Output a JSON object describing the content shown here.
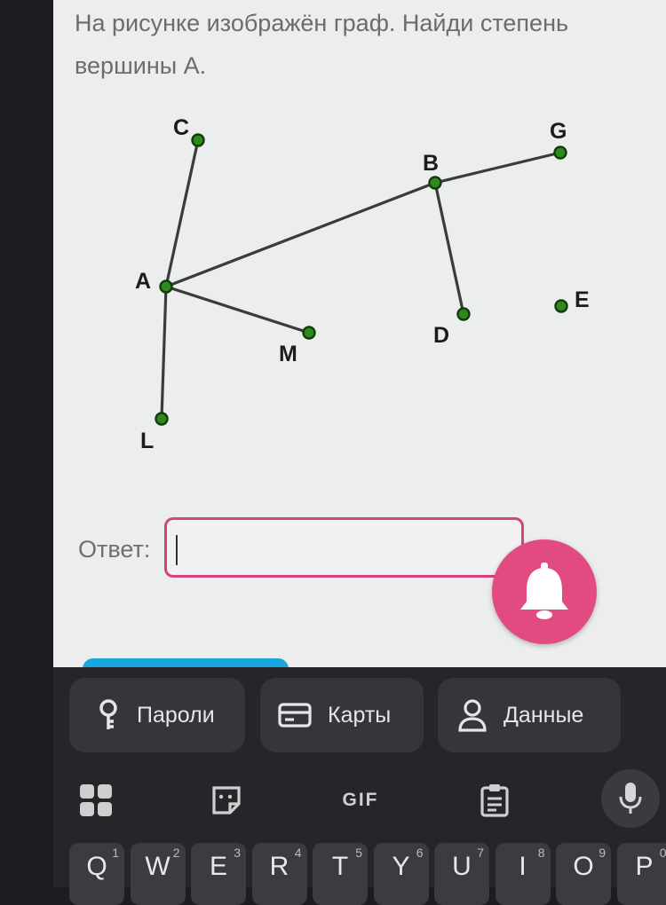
{
  "task": {
    "text": "На рисунке изображён граф. Найди степень вершины А."
  },
  "graph": {
    "vertices": [
      {
        "id": "C",
        "label": "C"
      },
      {
        "id": "B",
        "label": "B"
      },
      {
        "id": "G",
        "label": "G"
      },
      {
        "id": "A",
        "label": "A"
      },
      {
        "id": "E",
        "label": "E"
      },
      {
        "id": "D",
        "label": "D"
      },
      {
        "id": "M",
        "label": "M"
      },
      {
        "id": "L",
        "label": "L"
      }
    ],
    "edges": [
      [
        "A",
        "C"
      ],
      [
        "A",
        "B"
      ],
      [
        "A",
        "M"
      ],
      [
        "A",
        "L"
      ],
      [
        "B",
        "G"
      ],
      [
        "B",
        "D"
      ]
    ]
  },
  "answer": {
    "label": "Ответ:",
    "value": ""
  },
  "colors": {
    "accent": "#d6417f",
    "bell": "#e24b82",
    "node": "#2f8a1e",
    "primary_button": "#18a6dc"
  },
  "keyboard": {
    "suggestions": [
      {
        "label": "Пароли",
        "icon": "key-icon"
      },
      {
        "label": "Карты",
        "icon": "card-icon"
      },
      {
        "label": "Данные",
        "icon": "person-icon"
      }
    ],
    "tools": {
      "apps": "apps-grid-icon",
      "sticker": "sticker-icon",
      "gif": "GIF",
      "clipboard": "clipboard-icon",
      "mic": "microphone-icon"
    },
    "row1": [
      {
        "key": "Q",
        "num": "1"
      },
      {
        "key": "W",
        "num": "2"
      },
      {
        "key": "E",
        "num": "3"
      },
      {
        "key": "R",
        "num": "4"
      },
      {
        "key": "T",
        "num": "5"
      },
      {
        "key": "Y",
        "num": "6"
      },
      {
        "key": "U",
        "num": "7"
      },
      {
        "key": "I",
        "num": "8"
      },
      {
        "key": "O",
        "num": "9"
      },
      {
        "key": "P",
        "num": "0"
      }
    ]
  }
}
